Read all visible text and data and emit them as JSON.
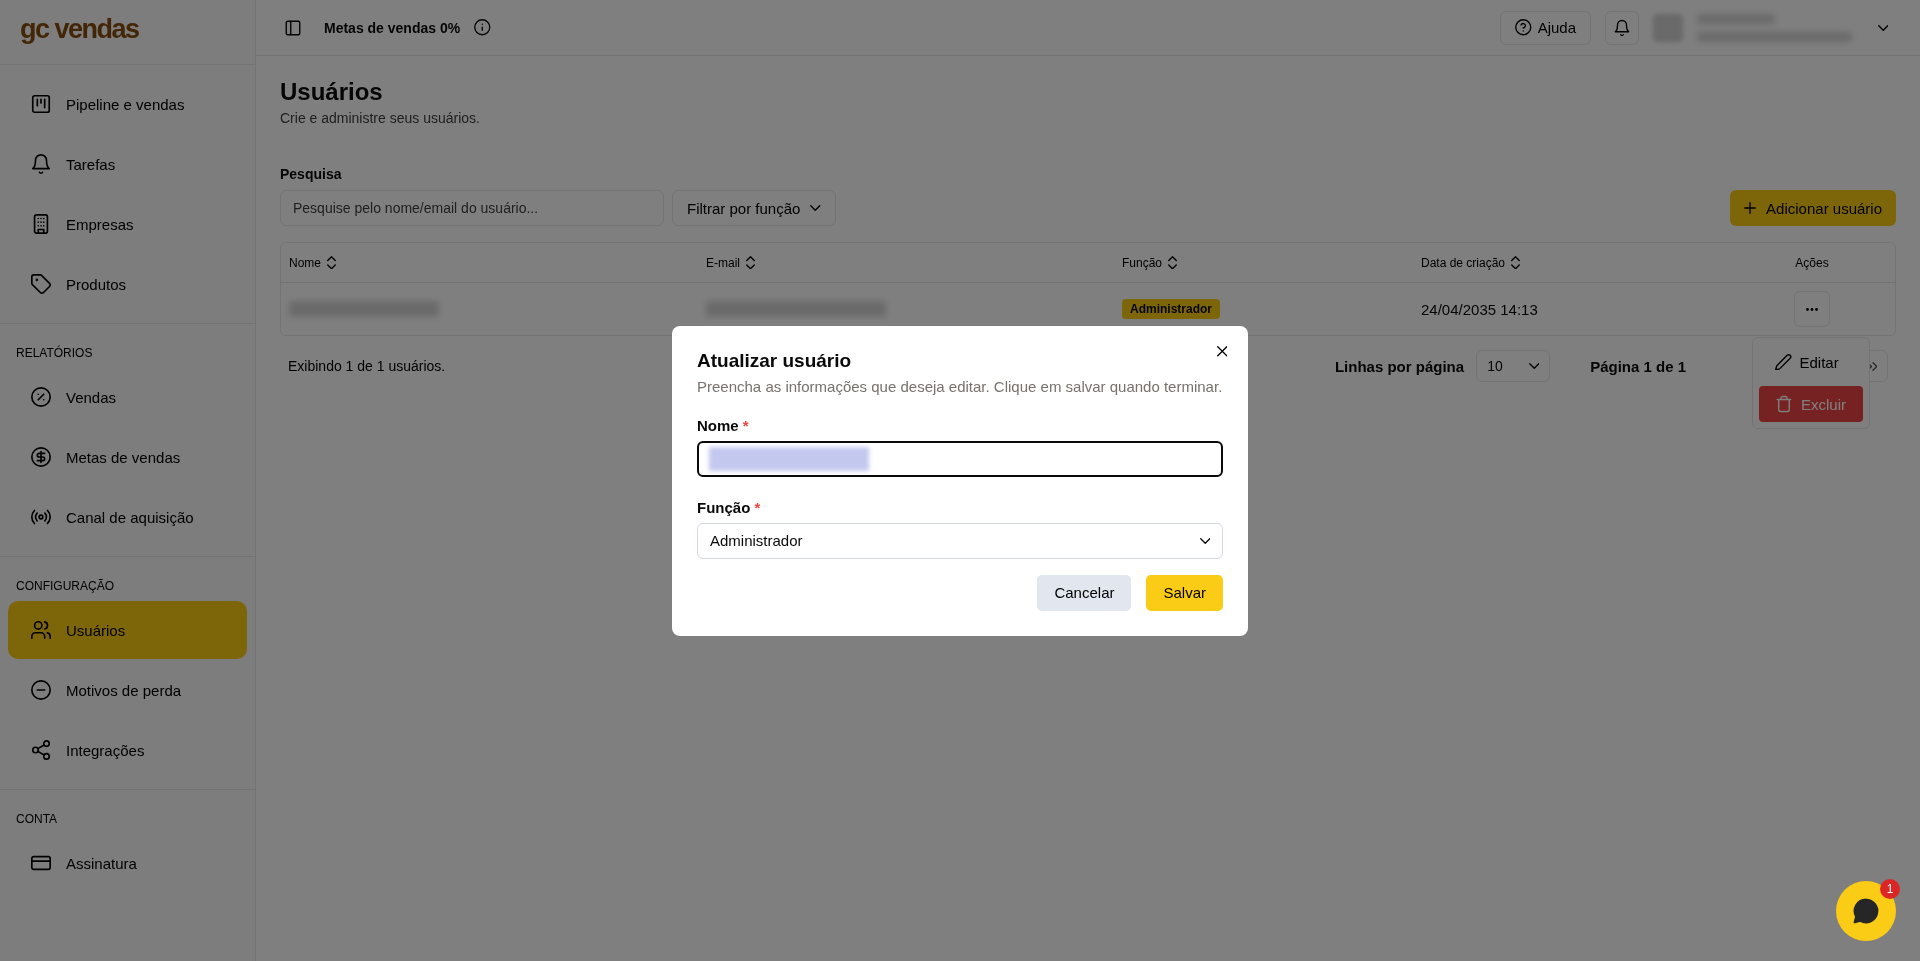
{
  "sidebar": {
    "logo": "gc vendas",
    "groups": [
      {
        "items": [
          {
            "label": "Pipeline e vendas",
            "selected": false
          },
          {
            "label": "Tarefas",
            "selected": false
          },
          {
            "label": "Empresas",
            "selected": false
          },
          {
            "label": "Produtos",
            "selected": false
          }
        ]
      },
      {
        "heading": "RELATÓRIOS",
        "items": [
          {
            "label": "Vendas",
            "selected": false
          },
          {
            "label": "Metas de vendas",
            "selected": false
          },
          {
            "label": "Canal de aquisição",
            "selected": false
          }
        ]
      },
      {
        "heading": "CONFIGURAÇÃO",
        "items": [
          {
            "label": "Usuários",
            "selected": true
          },
          {
            "label": "Motivos de perda",
            "selected": false
          },
          {
            "label": "Integrações",
            "selected": false
          }
        ]
      },
      {
        "heading": "CONTA",
        "items": [
          {
            "label": "Assinatura",
            "selected": false
          }
        ]
      }
    ]
  },
  "header": {
    "goal": "Metas de vendas 0%",
    "help": "Ajuda"
  },
  "page": {
    "title": "Usuários",
    "subtitle": "Crie e administre seus usuários.",
    "search_label": "Pesquisa",
    "search_placeholder": "Pesquise pelo nome/email do usuário...",
    "filter": "Filtrar por função",
    "add": "Adicionar usuário"
  },
  "table": {
    "columns": [
      {
        "label": "Nome",
        "sortable": true
      },
      {
        "label": "E-mail",
        "sortable": true
      },
      {
        "label": "Função",
        "sortable": true
      },
      {
        "label": "Data de criação",
        "sortable": true
      },
      {
        "label": "Ações",
        "sortable": false
      }
    ],
    "rows": [
      {
        "role": "Administrador",
        "created": "24/04/2035 14:13"
      }
    ]
  },
  "footer": {
    "showing": "Exibindo 1 de 1 usuários.",
    "rows_label": "Linhas por página",
    "rows_value": "10",
    "page": "Página 1 de 1"
  },
  "row_menu": [
    {
      "label": "Editar",
      "kind": "normal"
    },
    {
      "label": "Excluir",
      "kind": "danger"
    }
  ],
  "dialog": {
    "title": "Atualizar usuário",
    "description": "Preencha as informações que deseja editar. Clique em salvar quando terminar.",
    "fields": [
      {
        "label": "Nome",
        "required_mark": "*",
        "kind": "text"
      },
      {
        "label": "Função",
        "required_mark": "*",
        "kind": "select",
        "value": "Administrador"
      }
    ],
    "buttons": [
      {
        "label": "Cancelar",
        "kind": "secondary"
      },
      {
        "label": "Salvar",
        "kind": "primary"
      }
    ]
  },
  "chat": {
    "badge": "1"
  }
}
